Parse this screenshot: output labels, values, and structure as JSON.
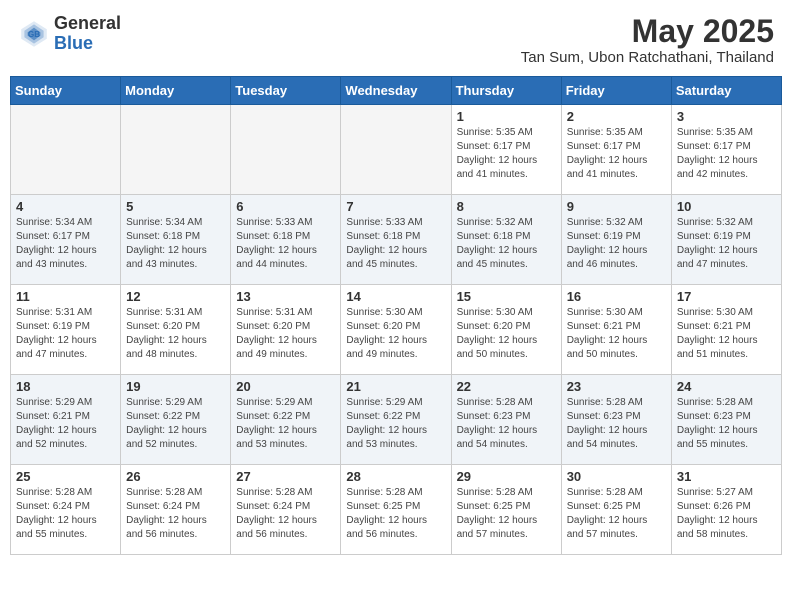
{
  "header": {
    "logo_general": "General",
    "logo_blue": "Blue",
    "month": "May 2025",
    "location": "Tan Sum, Ubon Ratchathani, Thailand"
  },
  "days_of_week": [
    "Sunday",
    "Monday",
    "Tuesday",
    "Wednesday",
    "Thursday",
    "Friday",
    "Saturday"
  ],
  "weeks": [
    {
      "alt": false,
      "days": [
        {
          "num": "",
          "info": ""
        },
        {
          "num": "",
          "info": ""
        },
        {
          "num": "",
          "info": ""
        },
        {
          "num": "",
          "info": ""
        },
        {
          "num": "1",
          "info": "Sunrise: 5:35 AM\nSunset: 6:17 PM\nDaylight: 12 hours\nand 41 minutes."
        },
        {
          "num": "2",
          "info": "Sunrise: 5:35 AM\nSunset: 6:17 PM\nDaylight: 12 hours\nand 41 minutes."
        },
        {
          "num": "3",
          "info": "Sunrise: 5:35 AM\nSunset: 6:17 PM\nDaylight: 12 hours\nand 42 minutes."
        }
      ]
    },
    {
      "alt": true,
      "days": [
        {
          "num": "4",
          "info": "Sunrise: 5:34 AM\nSunset: 6:17 PM\nDaylight: 12 hours\nand 43 minutes."
        },
        {
          "num": "5",
          "info": "Sunrise: 5:34 AM\nSunset: 6:18 PM\nDaylight: 12 hours\nand 43 minutes."
        },
        {
          "num": "6",
          "info": "Sunrise: 5:33 AM\nSunset: 6:18 PM\nDaylight: 12 hours\nand 44 minutes."
        },
        {
          "num": "7",
          "info": "Sunrise: 5:33 AM\nSunset: 6:18 PM\nDaylight: 12 hours\nand 45 minutes."
        },
        {
          "num": "8",
          "info": "Sunrise: 5:32 AM\nSunset: 6:18 PM\nDaylight: 12 hours\nand 45 minutes."
        },
        {
          "num": "9",
          "info": "Sunrise: 5:32 AM\nSunset: 6:19 PM\nDaylight: 12 hours\nand 46 minutes."
        },
        {
          "num": "10",
          "info": "Sunrise: 5:32 AM\nSunset: 6:19 PM\nDaylight: 12 hours\nand 47 minutes."
        }
      ]
    },
    {
      "alt": false,
      "days": [
        {
          "num": "11",
          "info": "Sunrise: 5:31 AM\nSunset: 6:19 PM\nDaylight: 12 hours\nand 47 minutes."
        },
        {
          "num": "12",
          "info": "Sunrise: 5:31 AM\nSunset: 6:20 PM\nDaylight: 12 hours\nand 48 minutes."
        },
        {
          "num": "13",
          "info": "Sunrise: 5:31 AM\nSunset: 6:20 PM\nDaylight: 12 hours\nand 49 minutes."
        },
        {
          "num": "14",
          "info": "Sunrise: 5:30 AM\nSunset: 6:20 PM\nDaylight: 12 hours\nand 49 minutes."
        },
        {
          "num": "15",
          "info": "Sunrise: 5:30 AM\nSunset: 6:20 PM\nDaylight: 12 hours\nand 50 minutes."
        },
        {
          "num": "16",
          "info": "Sunrise: 5:30 AM\nSunset: 6:21 PM\nDaylight: 12 hours\nand 50 minutes."
        },
        {
          "num": "17",
          "info": "Sunrise: 5:30 AM\nSunset: 6:21 PM\nDaylight: 12 hours\nand 51 minutes."
        }
      ]
    },
    {
      "alt": true,
      "days": [
        {
          "num": "18",
          "info": "Sunrise: 5:29 AM\nSunset: 6:21 PM\nDaylight: 12 hours\nand 52 minutes."
        },
        {
          "num": "19",
          "info": "Sunrise: 5:29 AM\nSunset: 6:22 PM\nDaylight: 12 hours\nand 52 minutes."
        },
        {
          "num": "20",
          "info": "Sunrise: 5:29 AM\nSunset: 6:22 PM\nDaylight: 12 hours\nand 53 minutes."
        },
        {
          "num": "21",
          "info": "Sunrise: 5:29 AM\nSunset: 6:22 PM\nDaylight: 12 hours\nand 53 minutes."
        },
        {
          "num": "22",
          "info": "Sunrise: 5:28 AM\nSunset: 6:23 PM\nDaylight: 12 hours\nand 54 minutes."
        },
        {
          "num": "23",
          "info": "Sunrise: 5:28 AM\nSunset: 6:23 PM\nDaylight: 12 hours\nand 54 minutes."
        },
        {
          "num": "24",
          "info": "Sunrise: 5:28 AM\nSunset: 6:23 PM\nDaylight: 12 hours\nand 55 minutes."
        }
      ]
    },
    {
      "alt": false,
      "days": [
        {
          "num": "25",
          "info": "Sunrise: 5:28 AM\nSunset: 6:24 PM\nDaylight: 12 hours\nand 55 minutes."
        },
        {
          "num": "26",
          "info": "Sunrise: 5:28 AM\nSunset: 6:24 PM\nDaylight: 12 hours\nand 56 minutes."
        },
        {
          "num": "27",
          "info": "Sunrise: 5:28 AM\nSunset: 6:24 PM\nDaylight: 12 hours\nand 56 minutes."
        },
        {
          "num": "28",
          "info": "Sunrise: 5:28 AM\nSunset: 6:25 PM\nDaylight: 12 hours\nand 56 minutes."
        },
        {
          "num": "29",
          "info": "Sunrise: 5:28 AM\nSunset: 6:25 PM\nDaylight: 12 hours\nand 57 minutes."
        },
        {
          "num": "30",
          "info": "Sunrise: 5:28 AM\nSunset: 6:25 PM\nDaylight: 12 hours\nand 57 minutes."
        },
        {
          "num": "31",
          "info": "Sunrise: 5:27 AM\nSunset: 6:26 PM\nDaylight: 12 hours\nand 58 minutes."
        }
      ]
    }
  ]
}
